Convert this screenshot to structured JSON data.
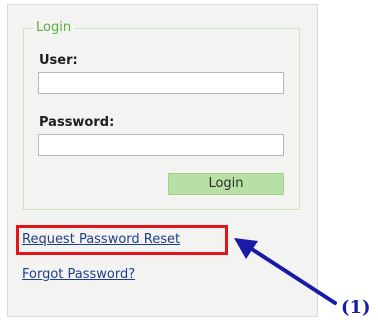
{
  "login_form": {
    "legend": "Login",
    "user_label": "User:",
    "user_value": "",
    "password_label": "Password:",
    "password_value": "",
    "login_button": "Login"
  },
  "links": {
    "request_reset": "Request Password Reset",
    "forgot_password": "Forgot Password?"
  },
  "annotation": {
    "callout_label": "(1)",
    "highlight_color": "#e5131a",
    "arrow_color": "#1a1aa8"
  },
  "colors": {
    "panel_bg": "#f3f3f1",
    "accent_green": "#5fae3d",
    "button_bg": "#b8e0a4",
    "link_color": "#1f3d8a"
  }
}
